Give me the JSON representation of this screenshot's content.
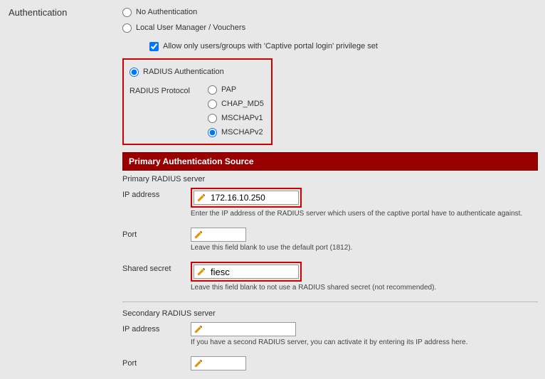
{
  "section_label": "Authentication",
  "auth_modes": {
    "none": "No Authentication",
    "local": "Local User Manager / Vouchers",
    "allow_note": "Allow only users/groups with 'Captive portal login' privilege set",
    "radius": "RADIUS Authentication"
  },
  "radius_protocol": {
    "label": "RADIUS Protocol",
    "pap": "PAP",
    "chap": "CHAP_MD5",
    "mschapv1": "MSCHAPv1",
    "mschapv2": "MSCHAPv2"
  },
  "primary": {
    "header": "Primary Authentication Source",
    "title": "Primary RADIUS server",
    "ip_label": "IP address",
    "ip_value": "172.16.10.250",
    "ip_help": "Enter the IP address of the RADIUS server which users of the captive portal have to authenticate against.",
    "port_label": "Port",
    "port_value": "",
    "port_help": "Leave this field blank to use the default port (1812).",
    "secret_label": "Shared secret",
    "secret_value": "fiesc",
    "secret_help": "Leave this field blank to not use a RADIUS shared secret (not recommended)."
  },
  "secondary": {
    "title": "Secondary RADIUS server",
    "ip_label": "IP address",
    "ip_value": "",
    "ip_help": "If you have a second RADIUS server, you can activate it by entering its IP address here.",
    "port_label": "Port",
    "port_value": ""
  }
}
